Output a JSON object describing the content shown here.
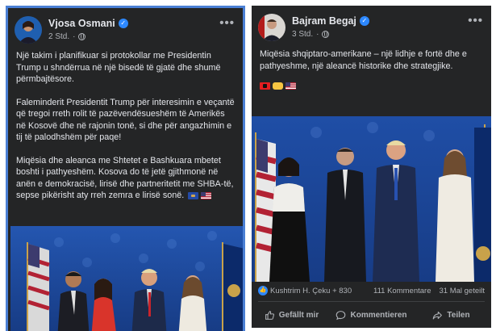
{
  "left_post": {
    "author": "Vjosa Osmani",
    "time": "2 Std.",
    "more": "•••",
    "paragraphs": [
      "Një takim i planifikuar si protokollar me Presidentin Trump u shndërrua në një bisedë të gjatë dhe shumë përmbajtësore.",
      "Faleminderit Presidentit Trump për interesimin e veçantë që tregoi rreth rolit të pazëvendësueshëm të Amerikës në Kosovë dhe në rajonin tonë, si dhe për angazhimin e tij të palodhshëm për paqe!",
      "Miqësia dhe aleanca me Shtetet e Bashkuara mbetet boshti i pathyeshëm. Kosova do të jetë gjithmonë në anën e demokracisë, lirisë dhe partneritetit me SHBA-të, sepse pikërisht aty rreh zemra e lirisë sonë."
    ],
    "emoji": [
      "kosovo-flag",
      "usa-flag"
    ]
  },
  "right_post": {
    "author": "Bajram Begaj",
    "time": "3 Std.",
    "more": "•••",
    "text": "Miqësia shqiptaro-amerikane – një lidhje e fortë dhe e pathyeshme, një aleancë historike dhe strategjike.",
    "emoji": [
      "albania-flag",
      "handshake",
      "usa-flag"
    ],
    "reactions": "Kushtrim H. Çeku + 830",
    "comments": "111 Kommentare",
    "shares": "31 Mal geteilt",
    "actions": {
      "like": "Gefällt mir",
      "comment": "Kommentieren",
      "share": "Teilen"
    }
  },
  "colors": {
    "card_bg": "#242526",
    "text": "#e4e6eb",
    "muted": "#b0b3b8",
    "verified": "#2d88ff",
    "selection_border": "#4a7fd4",
    "photo_backdrop": "#1b3f86"
  }
}
